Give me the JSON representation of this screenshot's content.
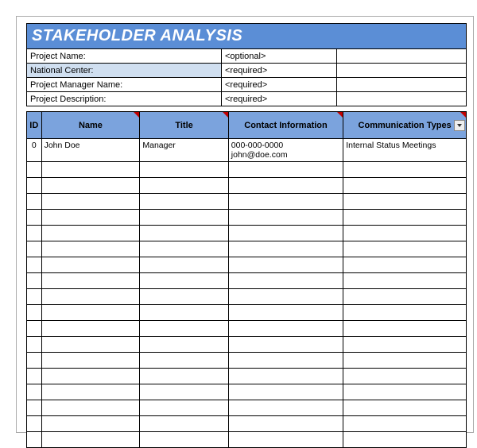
{
  "title": "STAKEHOLDER ANALYSIS",
  "meta": {
    "project_name_label": "Project Name:",
    "project_name_hint": "<optional>",
    "national_center_label": "National Center:",
    "national_center_hint": "<required>",
    "manager_label": "Project Manager Name:",
    "manager_hint": "<required>",
    "description_label": "Project Description:",
    "description_hint": "<required>"
  },
  "columns": {
    "id": "ID",
    "name": "Name",
    "title": "Title",
    "contact": "Contact Information",
    "comm": "Communication Types"
  },
  "rows": [
    {
      "id": "0",
      "name": "John Doe",
      "title": "Manager",
      "contact": "000-000-0000\njohn@doe.com",
      "comm": "Internal Status Meetings"
    }
  ],
  "empty_row_count": 18
}
